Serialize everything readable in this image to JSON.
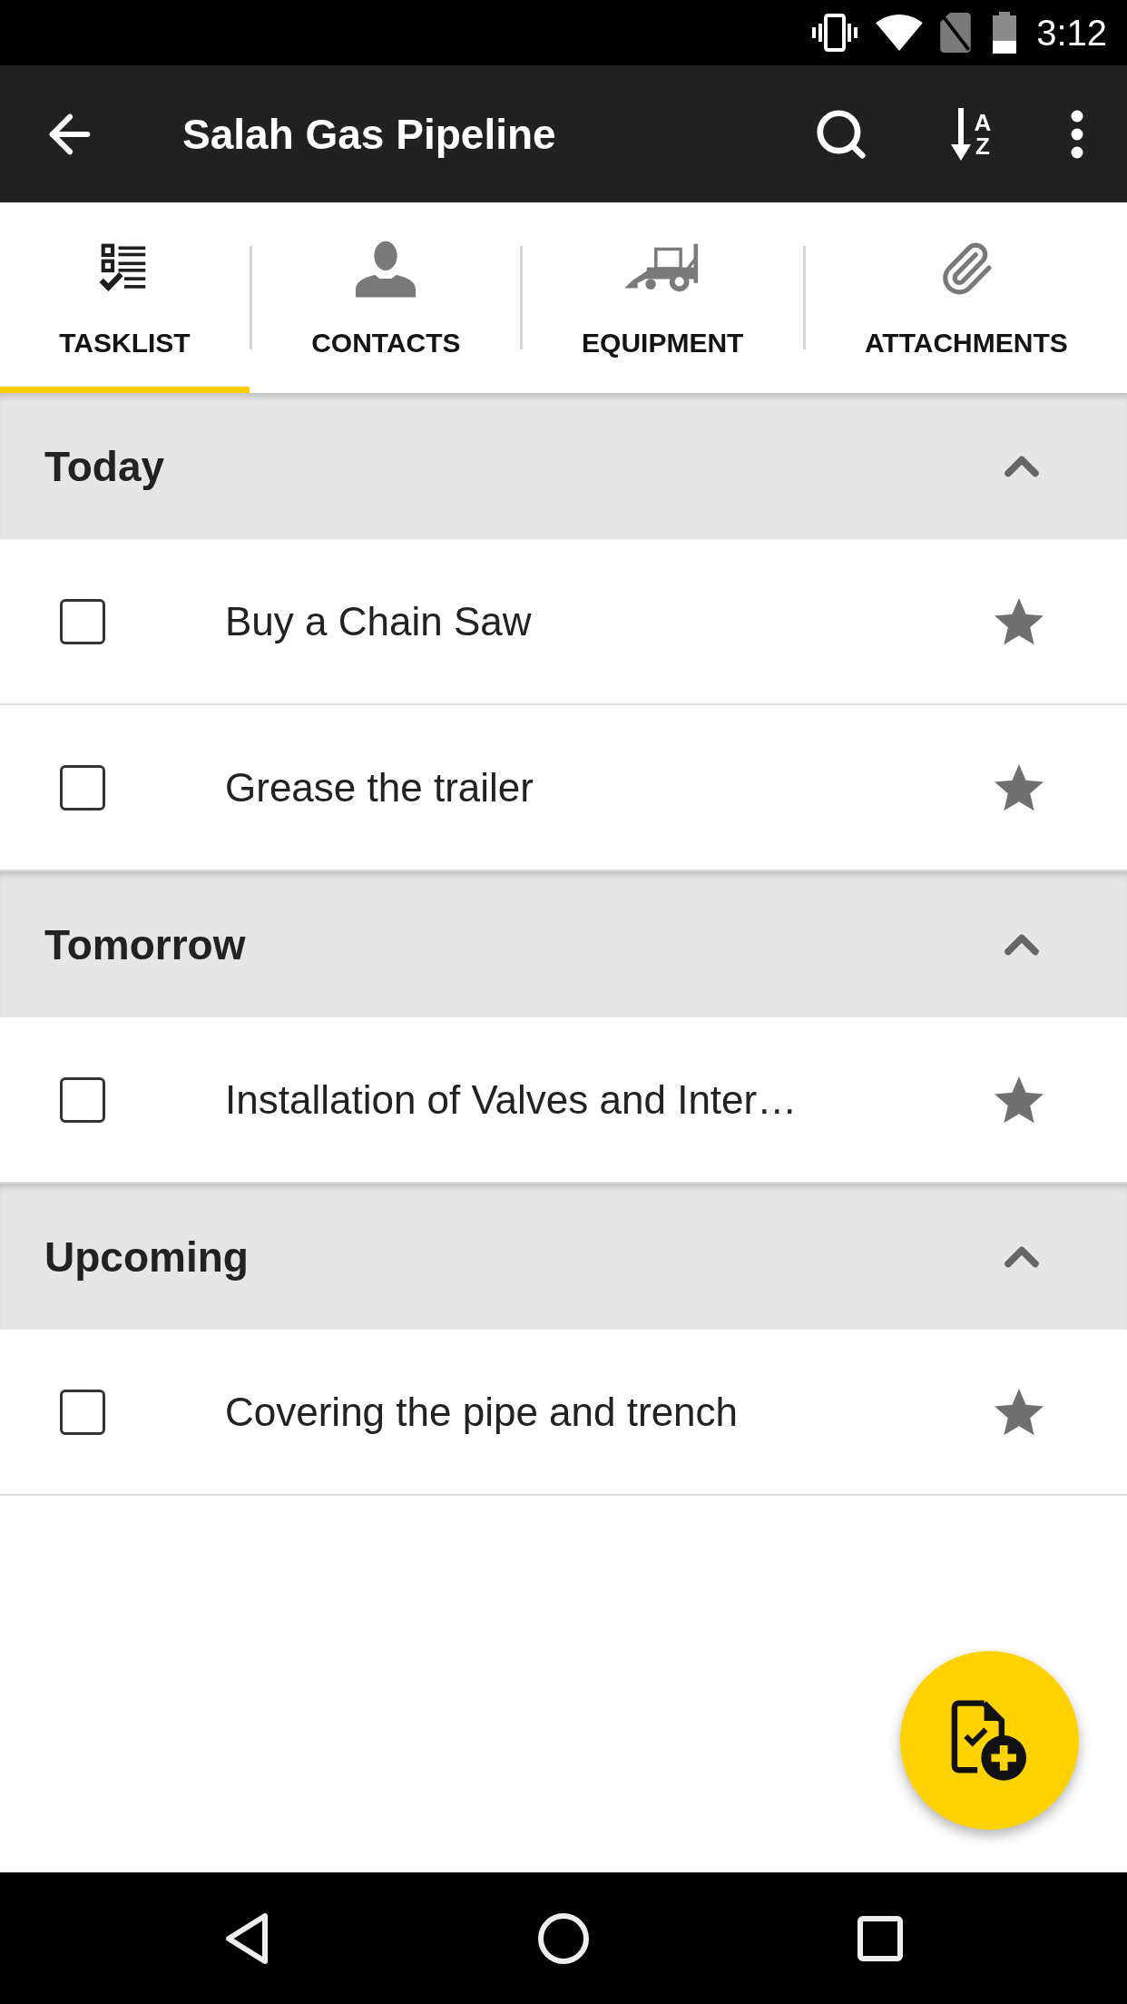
{
  "status_bar": {
    "time": "3:12"
  },
  "app_bar": {
    "title": "Salah Gas Pipeline",
    "sort_letters": [
      "A",
      "Z"
    ]
  },
  "tabs": [
    {
      "kind": "tasklist",
      "label": "TASKLIST",
      "selected": true
    },
    {
      "kind": "contacts",
      "label": "CONTACTS",
      "selected": false
    },
    {
      "kind": "equipment",
      "label": "EQUIPMENT",
      "selected": false
    },
    {
      "kind": "attachments",
      "label": "ATTACHMENTS",
      "selected": false
    }
  ],
  "sections": [
    {
      "title": "Today",
      "expanded": true,
      "tasks": [
        {
          "text": "Buy a Chain Saw",
          "checked": false
        },
        {
          "text": "Grease the trailer",
          "checked": false
        }
      ]
    },
    {
      "title": "Tomorrow",
      "expanded": true,
      "tasks": [
        {
          "text": "Installation of Valves and Inter…",
          "checked": false
        }
      ]
    },
    {
      "title": "Upcoming",
      "expanded": true,
      "tasks": [
        {
          "text": "Covering the pipe and trench",
          "checked": false
        }
      ]
    }
  ]
}
